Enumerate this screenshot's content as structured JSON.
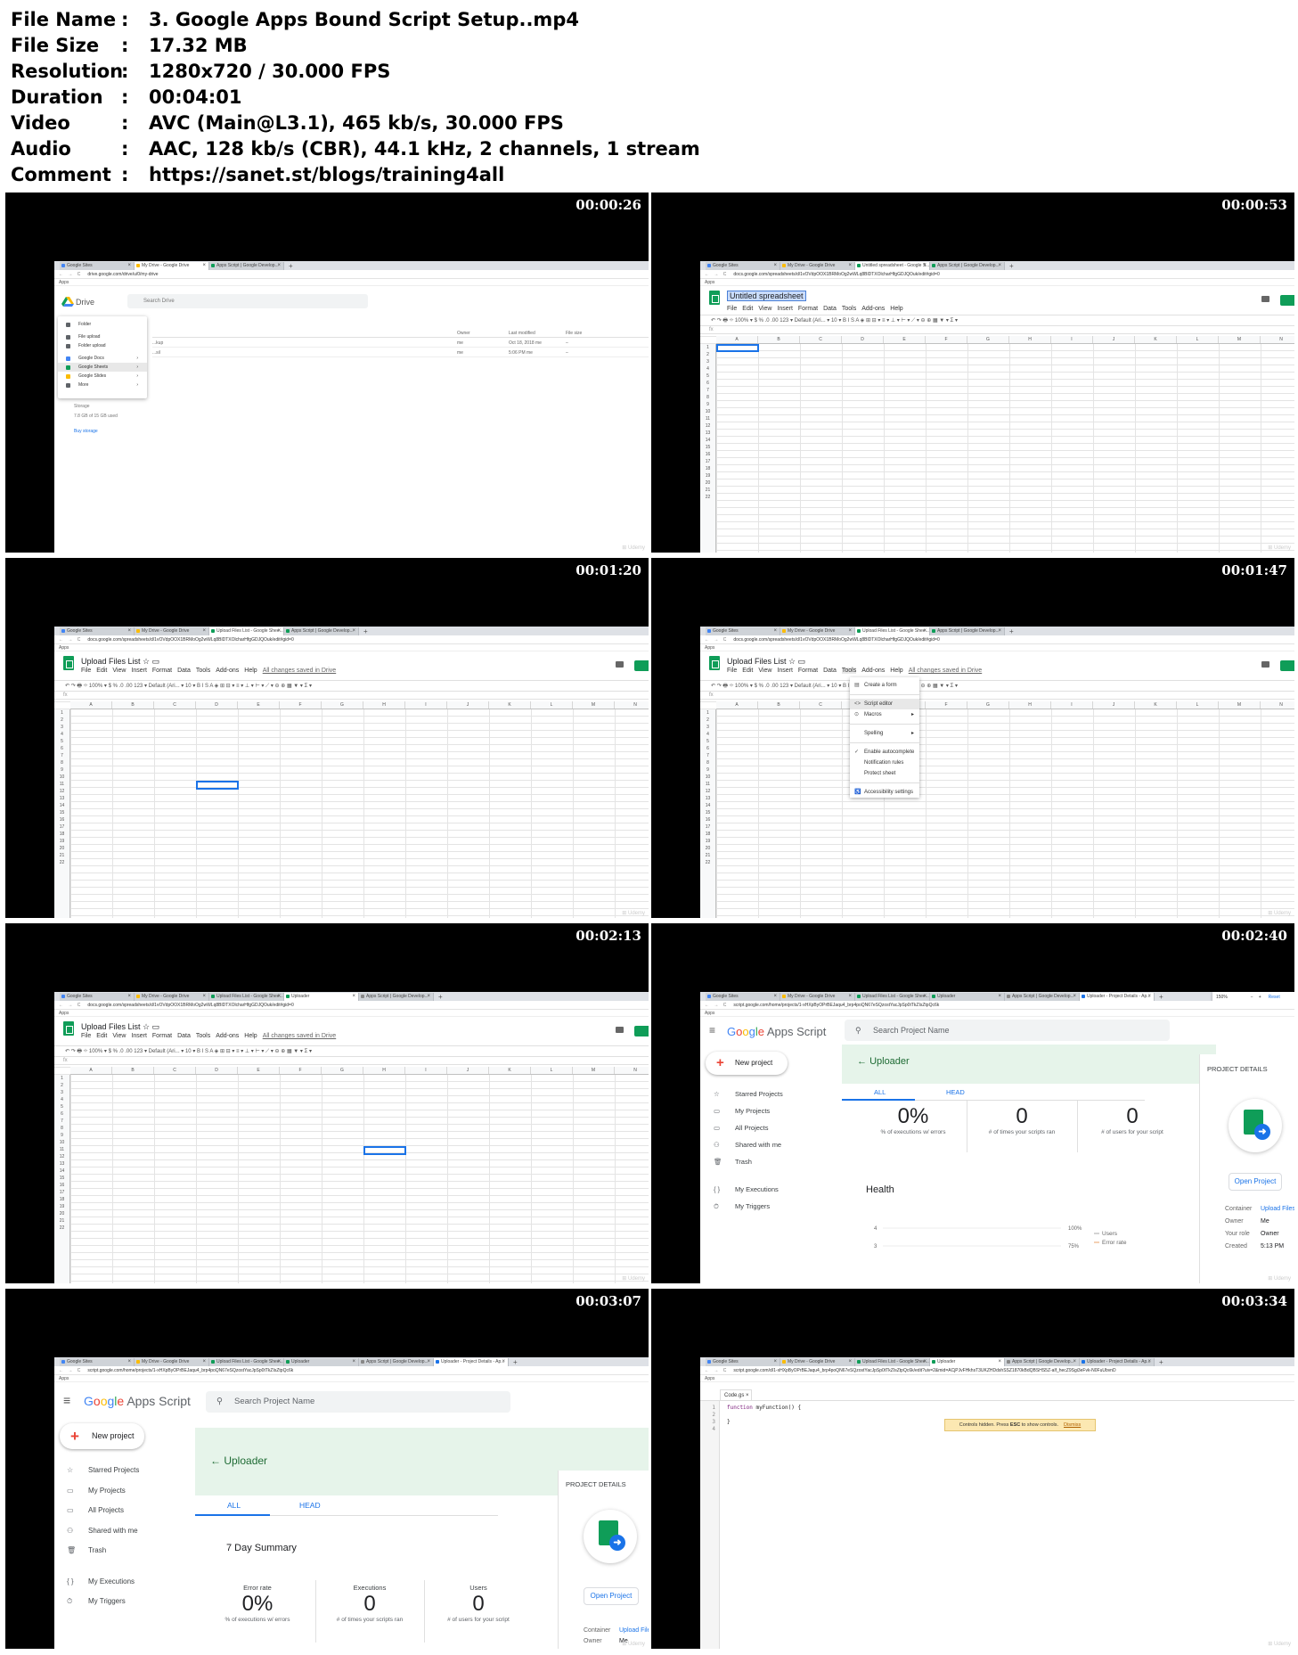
{
  "info": [
    {
      "key": "File Name",
      "sep": ":",
      "value": "3. Google Apps Bound Script Setup..mp4"
    },
    {
      "key": "File Size",
      "sep": ":",
      "value": "17.32 MB"
    },
    {
      "key": "Resolution",
      "sep": ":",
      "value": "1280x720 / 30.000 FPS"
    },
    {
      "key": "Duration",
      "sep": ":",
      "value": "00:04:01"
    },
    {
      "key": "Video",
      "sep": ":",
      "value": "AVC (Main@L3.1), 465 kb/s, 30.000 FPS"
    },
    {
      "key": "Audio",
      "sep": ":",
      "value": "AAC, 128 kb/s (CBR), 44.1 kHz, 2 channels, 1 stream"
    },
    {
      "key": "Comment",
      "sep": ":",
      "value": "https://sanet.st/blogs/training4all"
    }
  ],
  "timestamps": [
    "00:00:26",
    "00:00:53",
    "00:01:20",
    "00:01:47",
    "00:02:13",
    "00:02:40",
    "00:03:07",
    "00:03:34"
  ],
  "common": {
    "bookmarks": "Apps",
    "columns": [
      "A",
      "B",
      "C",
      "D",
      "E",
      "F",
      "G",
      "H",
      "I",
      "J",
      "K",
      "L",
      "M",
      "N"
    ],
    "rows": [
      "1",
      "2",
      "3",
      "4",
      "5",
      "6",
      "7",
      "8",
      "9",
      "10",
      "11",
      "12",
      "13",
      "14",
      "15",
      "16",
      "17",
      "18",
      "19",
      "20",
      "21",
      "22"
    ],
    "toolbar": "↶ ↷ 🖶 ⌖   100% ▾   $  %  .0  .00  123 ▾   Default (Ari... ▾   10 ▾   B  I  S  A   ◈  ⊞  ⊟ ▾   ≡ ▾  ⊥ ▾  ⊢ ▾  ⟋ ▾   ⊖  ⊕  ▦  ▼ ▾  Σ ▾",
    "fx": "fx",
    "watermark": "⊞ Udemy",
    "nav": "← → C"
  },
  "f1": {
    "tabs": [
      "Google Sites",
      "My Drive - Google Drive",
      "Apps Script | Google Develop..."
    ],
    "url": "drive.google.com/drive/u/0/my-drive",
    "app": "Drive",
    "search": "Search Drive",
    "menu": [
      "Folder",
      "",
      "File upload",
      "Folder upload",
      "",
      "Google Docs",
      "Google Sheets",
      "Google Slides",
      "More"
    ],
    "cols": {
      "owner": "Owner",
      "modified": "Last modified",
      "size": "File size"
    },
    "rows": [
      {
        "name": "...kup",
        "owner": "me",
        "modified": "Oct 18, 2018 me",
        "size": "–"
      },
      {
        "name": "...sil",
        "owner": "me",
        "modified": "5:06 PM me",
        "size": "–"
      }
    ],
    "side": {
      "storage": "Storage",
      "used": "7.8 GB of 15 GB used",
      "buy": "Buy storage"
    }
  },
  "f2": {
    "tabs": [
      "Google Sites",
      "My Drive - Google Drive",
      "Untitled spreadsheet - Google S...",
      "Apps Script | Google Develop..."
    ],
    "url": "docs.google.com/spreadsheets/d/1vOVdpOOX1BRMoOg2wWLq8BlDTXOlcharHfgGDJQOuk/edit#gid=0",
    "title": "Untitled spreadsheet",
    "menu": [
      "File",
      "Edit",
      "View",
      "Insert",
      "Format",
      "Data",
      "Tools",
      "Add-ons",
      "Help"
    ]
  },
  "f3": {
    "tabs": [
      "Google Sites",
      "My Drive - Google Drive",
      "Upload Files List - Google Shee...",
      "Apps Script | Google Develop..."
    ],
    "url": "docs.google.com/spreadsheets/d/1vOVdpOOX1BRMoOg2wWLq8BlDTXOlcharHfgGDJQOuk/edit#gid=0",
    "title": "Upload Files List",
    "menu": [
      "File",
      "Edit",
      "View",
      "Insert",
      "Format",
      "Data",
      "Tools",
      "Add-ons",
      "Help"
    ],
    "saved": "All changes saved in Drive"
  },
  "f4": {
    "tabs": [
      "Google Sites",
      "My Drive - Google Drive",
      "Upload Files List - Google Shee...",
      "Apps Script | Google Develop..."
    ],
    "url": "docs.google.com/spreadsheets/d/1vOVdpOOX1BRMoOg2wWLq8BlDTXOlcharHfgGDJQOuk/edit#gid=0",
    "title": "Upload Files List",
    "menu": [
      "File",
      "Edit",
      "View",
      "Insert",
      "Format",
      "Data",
      "Tools",
      "Add-ons",
      "Help"
    ],
    "saved": "All changes saved in Drive",
    "tools": [
      "Create a form",
      "",
      "Script editor",
      "Macros",
      "",
      "Spelling",
      "",
      "Enable autocomplete",
      "Notification rules",
      "Protect sheet",
      "",
      "Accessibility settings"
    ]
  },
  "f5": {
    "tabs": [
      "Google Sites",
      "My Drive - Google Drive",
      "Upload Files List - Google Shee...",
      "Uploader",
      "Apps Script | Google Develop..."
    ],
    "url": "docs.google.com/spreadsheets/d/1vOVdpOOX1BRMoOg2wWLq8BlDTXOlcharHfgGDJQOuk/edit#gid=0",
    "title": "Upload Files List",
    "menu": [
      "File",
      "Edit",
      "View",
      "Insert",
      "Format",
      "Data",
      "Tools",
      "Add-ons",
      "Help"
    ],
    "saved": "All changes saved in Drive"
  },
  "f6": {
    "tabs": [
      "Google Sites",
      "My Drive - Google Drive",
      "Upload Files List - Google Shee...",
      "Uploader",
      "Apps Script | Google Develop...",
      "Uploader - Project Details - Ap..."
    ],
    "zoom": "150%",
    "reset": "Reset",
    "url": "script.google.com/home/projects/1-xHXpByOPrBEJaqu4_brp4poQN67eSQzostYacJpSp0tTkZIsZtpQc6k",
    "logo": [
      "Google",
      " Apps Script"
    ],
    "search": "Search Project Name",
    "newproj": "New project",
    "nav": [
      "Starred Projects",
      "My Projects",
      "All Projects",
      "Shared with me",
      "Trash",
      "",
      "My Executions",
      "My Triggers"
    ],
    "project": "Uploader",
    "tabsRow": [
      "ALL",
      "HEAD"
    ],
    "stats": [
      {
        "n": "0%",
        "l": "% of executions w/ errors"
      },
      {
        "n": "0",
        "l": "# of times your scripts ran"
      },
      {
        "n": "0",
        "l": "# of users for your script"
      }
    ],
    "health": "Health",
    "chartY": [
      "4",
      "3"
    ],
    "chartP": [
      "100%",
      "75%"
    ],
    "legend": [
      "Users",
      "Error rate"
    ],
    "pd": "PROJECT DETAILS",
    "open": "Open Project",
    "kv": [
      {
        "k": "Container",
        "v": "Upload Files"
      },
      {
        "k": "Owner",
        "v": "Me"
      },
      {
        "k": "Your role",
        "v": "Owner"
      },
      {
        "k": "Created",
        "v": "5:13 PM"
      }
    ]
  },
  "f7": {
    "tabs": [
      "Google Sites",
      "My Drive - Google Drive",
      "Upload Files List - Google Shee...",
      "Uploader",
      "Apps Script | Google Develop...",
      "Uploader - Project Details - Ap..."
    ],
    "url": "script.google.com/home/projects/1-xHXpByOPrBEJaqu4_brp4poQN67eSQzostYacJpSp0tTkZIsZtpQc6k",
    "logo": [
      "Google",
      " Apps Script"
    ],
    "search": "Search Project Name",
    "newproj": "New project",
    "nav": [
      "Starred Projects",
      "My Projects",
      "All Projects",
      "Shared with me",
      "Trash",
      "",
      "My Executions",
      "My Triggers"
    ],
    "project": "Uploader",
    "tabsRow": [
      "ALL",
      "HEAD"
    ],
    "summary": "7 Day Summary",
    "stats": [
      {
        "t": "Error rate",
        "n": "0%",
        "l": "% of executions w/ errors"
      },
      {
        "t": "Executions",
        "n": "0",
        "l": "# of times your scripts ran"
      },
      {
        "t": "Users",
        "n": "0",
        "l": "# of users for your script"
      }
    ],
    "pd": "PROJECT DETAILS",
    "open": "Open Project",
    "kv": [
      {
        "k": "Container",
        "v": "Upload Files"
      },
      {
        "k": "Owner",
        "v": "Me"
      }
    ]
  },
  "f8": {
    "tabs": [
      "Google Sites",
      "My Drive - Google Drive",
      "Upload Files List - Google Shee...",
      "Uploader",
      "Apps Script | Google Develop...",
      "Uploader - Project Details - Ap..."
    ],
    "url": "script.google.com/d/1-xHXpByOPrBEJaqu4_brp4poQN67eSQzostYacJpSp0tTkZIsZtpQc6k/edit?uiv=2&mid=ACjPJvFHkhsT3UKZHDdshSSZ1870kBdQBSHS5Z-alf_hecZ9Sgi3eFvk-N0FuUbvnD",
    "file": "Code.gs",
    "lines": [
      "1",
      "2",
      "3",
      "4"
    ],
    "code": "function myFunction() {\n  \n}",
    "kw": "function",
    "rest": " myFunction() {\n  \n}",
    "toast": {
      "pre": "Controls hidden. Press ",
      "key": "ESC",
      "post": " to show controls.",
      "dismiss": "Dismiss"
    }
  }
}
